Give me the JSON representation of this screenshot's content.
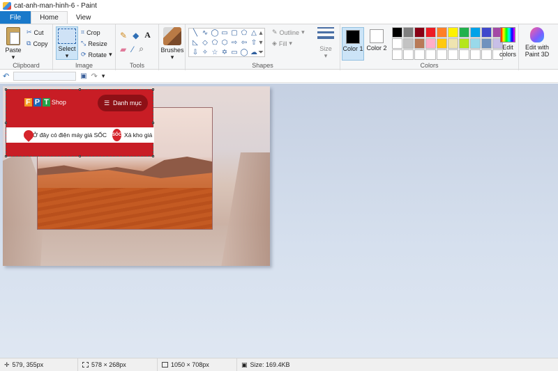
{
  "window": {
    "title": "cat-anh-man-hinh-6 - Paint"
  },
  "tabs": [
    {
      "label": "File"
    },
    {
      "label": "Home"
    },
    {
      "label": "View"
    }
  ],
  "ribbon": {
    "clipboard": {
      "label": "Clipboard",
      "paste": "Paste",
      "cut": "Cut",
      "copy": "Copy"
    },
    "image": {
      "label": "Image",
      "select": "Select",
      "crop": "Crop",
      "resize": "Resize",
      "rotate": "Rotate"
    },
    "tools": {
      "label": "Tools"
    },
    "brushes": {
      "label": "Brushes"
    },
    "shapes": {
      "label": "Shapes",
      "outline": "Outline",
      "fill": "Fill",
      "size": "Size"
    },
    "colors": {
      "label": "Colors",
      "color1": "Color 1",
      "color2": "Color 2",
      "edit_colors": "Edit colors",
      "edit_paint3d": "Edit with Paint 3D",
      "color1_value": "#000000",
      "color2_value": "#ffffff",
      "palette": [
        "#000000",
        "#7f7f7f",
        "#880015",
        "#ed1c24",
        "#ff7f27",
        "#fff200",
        "#22b14c",
        "#00a2e8",
        "#3f48cc",
        "#a349a4",
        "#ffffff",
        "#c3c3c3",
        "#b97a57",
        "#ffaec9",
        "#ffc90e",
        "#efe4b0",
        "#b5e61d",
        "#99d9ea",
        "#7092be",
        "#c8bfe7",
        "#ffffff",
        "#ffffff",
        "#ffffff",
        "#ffffff",
        "#ffffff",
        "#ffffff",
        "#ffffff",
        "#ffffff",
        "#ffffff",
        "#ffffff"
      ]
    }
  },
  "canvas": {
    "banner": {
      "brand": "Shop",
      "menu_label": "Danh mục",
      "promo_text": "Ở đây có điện máy giá SỐC",
      "badge": "SỐC",
      "promo_text2": "Xả kho giá số"
    }
  },
  "status": {
    "cursor": "579, 355px",
    "selection": "578 × 268px",
    "image_size": "1050 × 708px",
    "file_size": "Size: 169.4KB"
  }
}
